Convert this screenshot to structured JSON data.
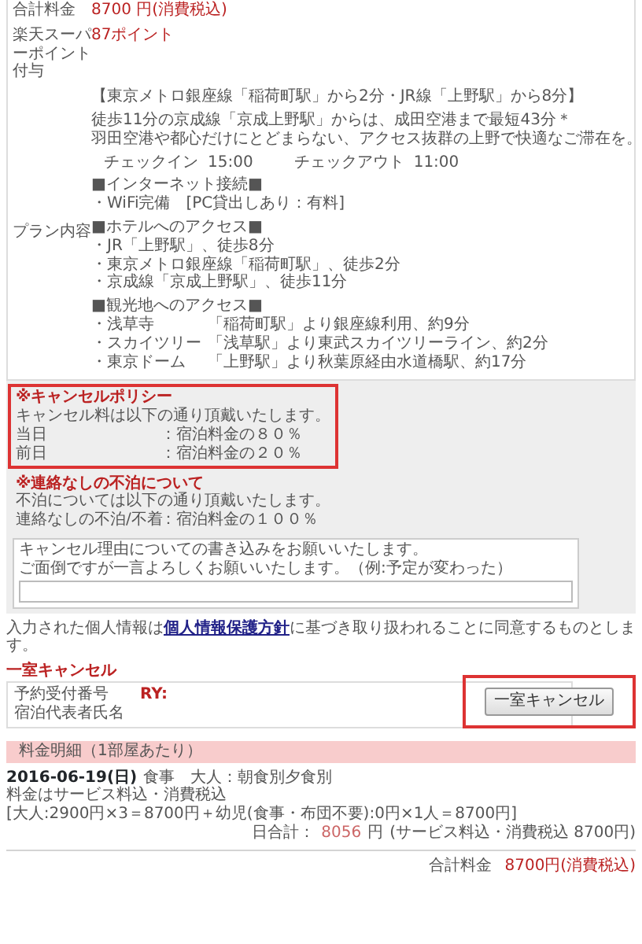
{
  "plan_table": {
    "rows": [
      {
        "label": "合計料金",
        "value": "8700 円(消費税込)"
      },
      {
        "label": "楽天スーパーポイント付与",
        "value": "87ポイント"
      }
    ],
    "plan": {
      "label": "プラン内容",
      "sections": [
        {
          "kind": "text",
          "lines": [
            "【東京メトロ銀座線「稲荷町駅」から2分・JR線「上野駅」から8分】"
          ]
        },
        {
          "kind": "text",
          "lines": [
            "徒歩11分の京成線「京成上野駅」からは、成田空港まで最短43分＊",
            "羽田空港や都心だけにとどまらない、アクセス抜群の上野で快適なご滞在を。"
          ]
        },
        {
          "kind": "times",
          "checkin_label": "チェックイン",
          "checkin_time": "15:00",
          "checkout_label": "チェックアウト",
          "checkout_time": "11:00"
        },
        {
          "kind": "text",
          "lines": [
            "■インターネット接続■",
            "・WiFi完備　[PC貸出しあり：有料]"
          ]
        },
        {
          "kind": "text",
          "lines": [
            "■ホテルへのアクセス■",
            "・JR「上野駅」、徒歩8分",
            "・東京メトロ銀座線「稲荷町駅」、徒歩2分",
            "・京成線「京成上野駅」、徒歩11分"
          ]
        },
        {
          "kind": "table",
          "heading": "■観光地へのアクセス■",
          "rows": [
            {
              "place": "・浅草寺",
              "route": "「稲荷町駅」より銀座線利用、約9分"
            },
            {
              "place": "・スカイツリー",
              "route": "「浅草駅」より東武スカイツリーライン、約2分"
            },
            {
              "place": "・東京ドーム",
              "route": "「上野駅」より秋葉原経由水道橋駅、約17分"
            }
          ]
        }
      ]
    }
  },
  "policies": [
    {
      "title": "※キャンセルポリシー",
      "intro": "キャンセル料は以下の通り頂戴いたします。",
      "highlighted": true,
      "rows": [
        {
          "label": "当日",
          "value": "：宿泊料金の８０％"
        },
        {
          "label": "前日",
          "value": "：宿泊料金の２０％"
        }
      ]
    },
    {
      "title": "※連絡なしの不泊について",
      "intro": "不泊については以下の通り頂戴いたします。",
      "highlighted": false,
      "rows": [
        {
          "label": "連絡なしの不泊/不着",
          "value": "：宿泊料金の１００％"
        }
      ]
    }
  ],
  "reason_box": {
    "lines": [
      "キャンセル理由についての書き込みをお願いいたします。",
      "ご面倒ですが一言よろしくお願いいたします。（例:予定が変わった）"
    ]
  },
  "privacy": {
    "before": "入力された個人情報は",
    "link": "個人情報保護方針",
    "after": "に基づき取り扱われることに同意するものとします。"
  },
  "room_cancel": {
    "title": "一室キャンセル",
    "rows": [
      {
        "label": "予約受付番号",
        "value": "RY:"
      },
      {
        "label": "宿泊代表者氏名"
      }
    ],
    "button": "一室キャンセル",
    "highlighted": true
  },
  "fees": {
    "header": "料金明細（1部屋あたり）",
    "date": "2016-06-19(日)",
    "meal": "食事　大人：朝食別夕食別",
    "note": "料金はサービス料込・消費税込",
    "breakdown": "[大人:2900円×3＝8700円＋幼児(食事・布団不要):0円×1人＝8700円]",
    "day_total_label": "日合計：",
    "day_total_amount": "8056",
    "day_total_unit": "円",
    "day_total_note": "(サービス料込・消費税込 8700円)",
    "total_label": "合計料金",
    "total_value": "8700円(消費税込)"
  }
}
